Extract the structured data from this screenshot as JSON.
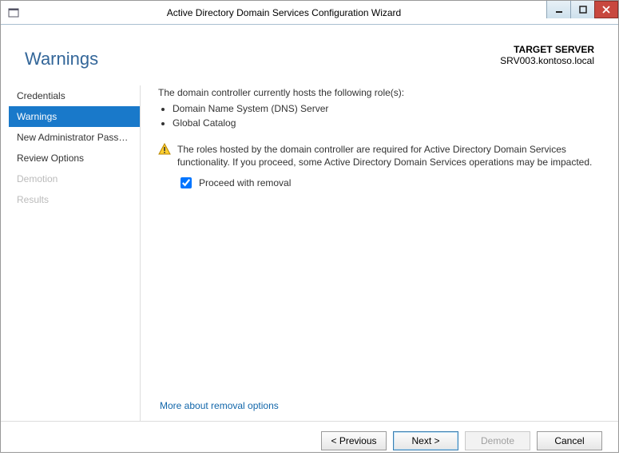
{
  "window": {
    "title": "Active Directory Domain Services Configuration Wizard"
  },
  "header": {
    "page_title": "Warnings",
    "target_label": "TARGET SERVER",
    "target_server": "SRV003.kontoso.local"
  },
  "sidebar": {
    "items": [
      {
        "label": "Credentials",
        "state": "normal"
      },
      {
        "label": "Warnings",
        "state": "active"
      },
      {
        "label": "New Administrator Passw...",
        "state": "normal"
      },
      {
        "label": "Review Options",
        "state": "normal"
      },
      {
        "label": "Demotion",
        "state": "disabled"
      },
      {
        "label": "Results",
        "state": "disabled"
      }
    ]
  },
  "content": {
    "intro": "The domain controller currently hosts the following role(s):",
    "roles": [
      "Domain Name System (DNS) Server",
      "Global Catalog"
    ],
    "warning_text": "The roles hosted by the domain controller are required for Active Directory Domain Services functionality. If you proceed, some Active Directory Domain Services operations may be impacted.",
    "proceed_checkbox_label": "Proceed with removal",
    "proceed_checked": true,
    "more_link": "More about removal options"
  },
  "footer": {
    "previous": "< Previous",
    "next": "Next >",
    "demote": "Demote",
    "cancel": "Cancel"
  }
}
